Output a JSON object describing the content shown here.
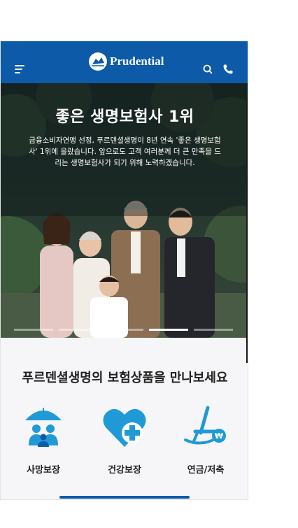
{
  "header": {
    "brand": "Prudential",
    "colors": {
      "brand_blue": "#0c5aa8"
    }
  },
  "hero": {
    "title": "좋은 생명보험사 1위",
    "description": "금융소비자연맹 선정, 푸르덴셜생명이 8년 연속 '좋은 생명보험사' 1위에 올랐습니다. 앞으로도 고객 여러분께 더 큰 만족을 드리는 생명보험사가 되기 위해 노력하겠습니다.",
    "slide_count": 5,
    "active_slide": 4
  },
  "products": {
    "title": "푸르덴셜생명의 보험상품을 만나보세요",
    "items": [
      {
        "label": "사망보장",
        "icon": "family-umbrella-icon"
      },
      {
        "label": "건강보장",
        "icon": "heart-plus-icon"
      },
      {
        "label": "연금/저축",
        "icon": "rocking-chair-icon"
      }
    ]
  }
}
